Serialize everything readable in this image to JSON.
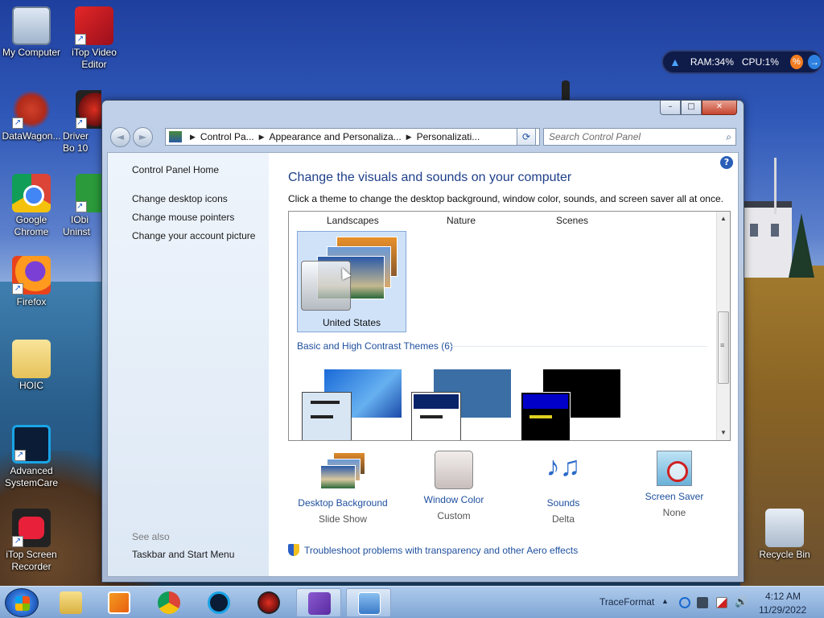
{
  "desktop": {
    "icons": [
      {
        "label": "My Computer"
      },
      {
        "label": "iTop Video Editor"
      },
      {
        "label": "DataWagon..."
      },
      {
        "label": "Driver Bo 10"
      },
      {
        "label": "Google Chrome"
      },
      {
        "label": "IObi Uninst"
      },
      {
        "label": "Firefox"
      },
      {
        "label": "HOIC"
      },
      {
        "label": "Advanced SystemCare"
      },
      {
        "label": "iTop Screen Recorder"
      },
      {
        "label": "Recycle Bin"
      }
    ],
    "gadget": {
      "ram": "RAM:34%",
      "cpu": "CPU:1%",
      "pct_symbol": "%",
      "go_symbol": "→"
    }
  },
  "window": {
    "caption": {
      "minimize": "–",
      "maximize": "□",
      "close": "✕"
    },
    "nav": {
      "back": "◄",
      "forward": "►"
    },
    "address": {
      "crumbs": [
        "Control Pa...",
        "Appearance and Personaliza...",
        "Personalizati..."
      ],
      "separator": "▶",
      "dropdown": "▼",
      "refresh": "⟳"
    },
    "search": {
      "placeholder": "Search Control Panel",
      "icon": "⌕"
    },
    "left_pane": {
      "home": "Control Panel Home",
      "links": [
        "Change desktop icons",
        "Change mouse pointers",
        "Change your account picture"
      ],
      "see_also": "See also",
      "see_also_links": [
        "Taskbar and Start Menu"
      ]
    },
    "help": "?",
    "heading": "Change the visuals and sounds on your computer",
    "subtext": "Click a theme to change the desktop background, window color, sounds, and screen saver all at once.",
    "themes": {
      "headers": [
        "Landscapes",
        "Nature",
        "Scenes"
      ],
      "selected": "United States",
      "basic_group": "Basic and High Contrast Themes (6)",
      "scroll_up": "▲",
      "scroll_down": "▼",
      "scroll_grip": "≡"
    },
    "bottom": [
      {
        "label": "Desktop Background",
        "value": "Slide Show",
        "icon": "desktop-background-icon"
      },
      {
        "label": "Window Color",
        "value": "Custom",
        "icon": "window-color-icon"
      },
      {
        "label": "Sounds",
        "value": "Delta",
        "icon": "sounds-icon",
        "glyph": "♪♫"
      },
      {
        "label": "Screen Saver",
        "value": "None",
        "icon": "screen-saver-icon"
      }
    ],
    "troubleshoot": "Troubleshoot problems with transparency and other Aero effects"
  },
  "taskbar": {
    "tray_label": "TraceFormat",
    "tray_arrow": "▲",
    "volume": "🔊",
    "time": "4:12 AM",
    "date": "11/29/2022"
  }
}
